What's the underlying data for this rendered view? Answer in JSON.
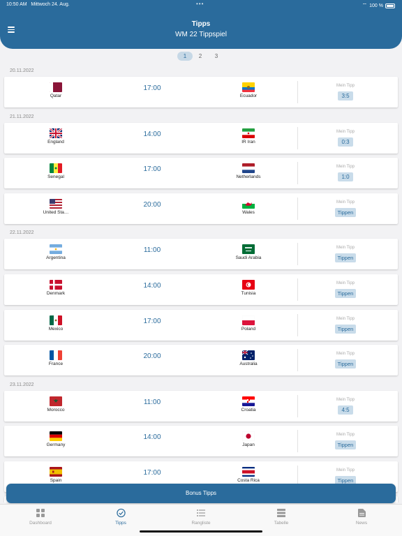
{
  "status": {
    "time": "10:50 AM",
    "date": "Mittwoch 24. Aug.",
    "battery": "100 %"
  },
  "header": {
    "title": "Tipps",
    "subtitle": "WM 22 Tippspiel"
  },
  "pager": {
    "pages": [
      "1",
      "2",
      "3"
    ],
    "active": "1"
  },
  "tip_label": "Mein Tipp",
  "colors": {
    "accent": "#2a6b9c",
    "tip_button_bg": "#c9dcea"
  },
  "dates": [
    "20.11.2022",
    "21.11.2022",
    "22.11.2022",
    "23.11.2022"
  ],
  "matches": [
    {
      "date": "20.11.2022",
      "home": "Qatar",
      "away": "Ecuador",
      "time": "17:00",
      "tip": "3:5"
    },
    {
      "date": "21.11.2022",
      "home": "England",
      "away": "IR Iran",
      "time": "14:00",
      "tip": "0:3"
    },
    {
      "date": "21.11.2022",
      "home": "Senegal",
      "away": "Netherlands",
      "time": "17:00",
      "tip": "1:0"
    },
    {
      "date": "21.11.2022",
      "home": "United Sta…",
      "away": "Wales",
      "time": "20:00",
      "tip": "Tippen"
    },
    {
      "date": "22.11.2022",
      "home": "Argentina",
      "away": "Saudi Arabia",
      "time": "11:00",
      "tip": "Tippen"
    },
    {
      "date": "22.11.2022",
      "home": "Denmark",
      "away": "Tunisia",
      "time": "14:00",
      "tip": "Tippen"
    },
    {
      "date": "22.11.2022",
      "home": "Mexico",
      "away": "Poland",
      "time": "17:00",
      "tip": "Tippen"
    },
    {
      "date": "22.11.2022",
      "home": "France",
      "away": "Australia",
      "time": "20:00",
      "tip": "Tippen"
    },
    {
      "date": "23.11.2022",
      "home": "Morocco",
      "away": "Croatia",
      "time": "11:00",
      "tip": "4:5"
    },
    {
      "date": "23.11.2022",
      "home": "Germany",
      "away": "Japan",
      "time": "14:00",
      "tip": "Tippen"
    },
    {
      "date": "23.11.2022",
      "home": "Spain",
      "away": "Costa Rica",
      "time": "17:00",
      "tip": "Tippen"
    }
  ],
  "bonus_button": "Bonus Tipps",
  "tabs": [
    {
      "label": "Dashboard",
      "icon": "dashboard-icon"
    },
    {
      "label": "Tipps",
      "icon": "check-circle-icon",
      "active": true
    },
    {
      "label": "Rangliste",
      "icon": "list-icon"
    },
    {
      "label": "Tabelle",
      "icon": "table-icon"
    },
    {
      "label": "News",
      "icon": "news-icon"
    }
  ]
}
